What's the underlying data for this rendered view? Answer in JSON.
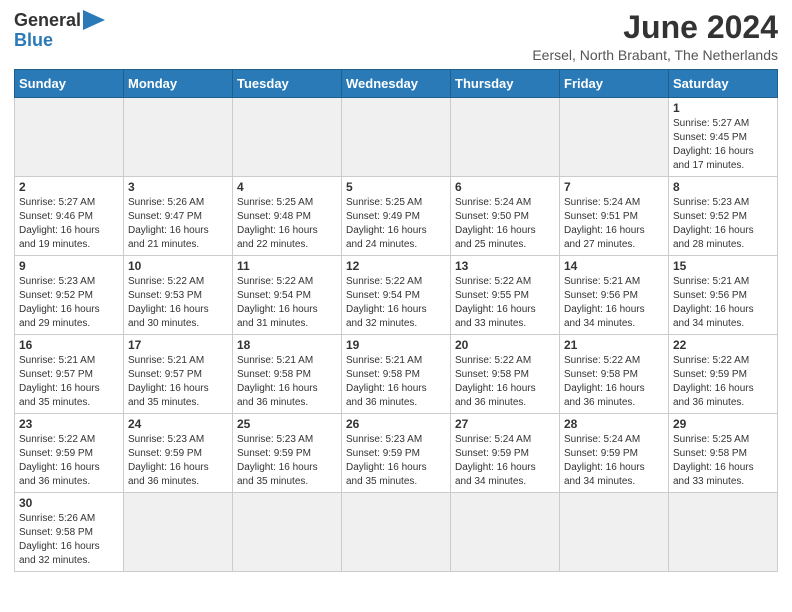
{
  "header": {
    "logo_general": "General",
    "logo_blue": "Blue",
    "month_title": "June 2024",
    "subtitle": "Eersel, North Brabant, The Netherlands"
  },
  "days_of_week": [
    "Sunday",
    "Monday",
    "Tuesday",
    "Wednesday",
    "Thursday",
    "Friday",
    "Saturday"
  ],
  "weeks": [
    [
      {
        "day": "",
        "info": ""
      },
      {
        "day": "",
        "info": ""
      },
      {
        "day": "",
        "info": ""
      },
      {
        "day": "",
        "info": ""
      },
      {
        "day": "",
        "info": ""
      },
      {
        "day": "",
        "info": ""
      },
      {
        "day": "1",
        "info": "Sunrise: 5:27 AM\nSunset: 9:45 PM\nDaylight: 16 hours\nand 17 minutes."
      }
    ],
    [
      {
        "day": "2",
        "info": "Sunrise: 5:27 AM\nSunset: 9:46 PM\nDaylight: 16 hours\nand 19 minutes."
      },
      {
        "day": "3",
        "info": "Sunrise: 5:26 AM\nSunset: 9:47 PM\nDaylight: 16 hours\nand 21 minutes."
      },
      {
        "day": "4",
        "info": "Sunrise: 5:25 AM\nSunset: 9:48 PM\nDaylight: 16 hours\nand 22 minutes."
      },
      {
        "day": "5",
        "info": "Sunrise: 5:25 AM\nSunset: 9:49 PM\nDaylight: 16 hours\nand 24 minutes."
      },
      {
        "day": "6",
        "info": "Sunrise: 5:24 AM\nSunset: 9:50 PM\nDaylight: 16 hours\nand 25 minutes."
      },
      {
        "day": "7",
        "info": "Sunrise: 5:24 AM\nSunset: 9:51 PM\nDaylight: 16 hours\nand 27 minutes."
      },
      {
        "day": "8",
        "info": "Sunrise: 5:23 AM\nSunset: 9:52 PM\nDaylight: 16 hours\nand 28 minutes."
      }
    ],
    [
      {
        "day": "9",
        "info": "Sunrise: 5:23 AM\nSunset: 9:52 PM\nDaylight: 16 hours\nand 29 minutes."
      },
      {
        "day": "10",
        "info": "Sunrise: 5:22 AM\nSunset: 9:53 PM\nDaylight: 16 hours\nand 30 minutes."
      },
      {
        "day": "11",
        "info": "Sunrise: 5:22 AM\nSunset: 9:54 PM\nDaylight: 16 hours\nand 31 minutes."
      },
      {
        "day": "12",
        "info": "Sunrise: 5:22 AM\nSunset: 9:54 PM\nDaylight: 16 hours\nand 32 minutes."
      },
      {
        "day": "13",
        "info": "Sunrise: 5:22 AM\nSunset: 9:55 PM\nDaylight: 16 hours\nand 33 minutes."
      },
      {
        "day": "14",
        "info": "Sunrise: 5:21 AM\nSunset: 9:56 PM\nDaylight: 16 hours\nand 34 minutes."
      },
      {
        "day": "15",
        "info": "Sunrise: 5:21 AM\nSunset: 9:56 PM\nDaylight: 16 hours\nand 34 minutes."
      }
    ],
    [
      {
        "day": "16",
        "info": "Sunrise: 5:21 AM\nSunset: 9:57 PM\nDaylight: 16 hours\nand 35 minutes."
      },
      {
        "day": "17",
        "info": "Sunrise: 5:21 AM\nSunset: 9:57 PM\nDaylight: 16 hours\nand 35 minutes."
      },
      {
        "day": "18",
        "info": "Sunrise: 5:21 AM\nSunset: 9:58 PM\nDaylight: 16 hours\nand 36 minutes."
      },
      {
        "day": "19",
        "info": "Sunrise: 5:21 AM\nSunset: 9:58 PM\nDaylight: 16 hours\nand 36 minutes."
      },
      {
        "day": "20",
        "info": "Sunrise: 5:22 AM\nSunset: 9:58 PM\nDaylight: 16 hours\nand 36 minutes."
      },
      {
        "day": "21",
        "info": "Sunrise: 5:22 AM\nSunset: 9:58 PM\nDaylight: 16 hours\nand 36 minutes."
      },
      {
        "day": "22",
        "info": "Sunrise: 5:22 AM\nSunset: 9:59 PM\nDaylight: 16 hours\nand 36 minutes."
      }
    ],
    [
      {
        "day": "23",
        "info": "Sunrise: 5:22 AM\nSunset: 9:59 PM\nDaylight: 16 hours\nand 36 minutes."
      },
      {
        "day": "24",
        "info": "Sunrise: 5:23 AM\nSunset: 9:59 PM\nDaylight: 16 hours\nand 36 minutes."
      },
      {
        "day": "25",
        "info": "Sunrise: 5:23 AM\nSunset: 9:59 PM\nDaylight: 16 hours\nand 35 minutes."
      },
      {
        "day": "26",
        "info": "Sunrise: 5:23 AM\nSunset: 9:59 PM\nDaylight: 16 hours\nand 35 minutes."
      },
      {
        "day": "27",
        "info": "Sunrise: 5:24 AM\nSunset: 9:59 PM\nDaylight: 16 hours\nand 34 minutes."
      },
      {
        "day": "28",
        "info": "Sunrise: 5:24 AM\nSunset: 9:59 PM\nDaylight: 16 hours\nand 34 minutes."
      },
      {
        "day": "29",
        "info": "Sunrise: 5:25 AM\nSunset: 9:58 PM\nDaylight: 16 hours\nand 33 minutes."
      }
    ],
    [
      {
        "day": "30",
        "info": "Sunrise: 5:26 AM\nSunset: 9:58 PM\nDaylight: 16 hours\nand 32 minutes."
      },
      {
        "day": "",
        "info": ""
      },
      {
        "day": "",
        "info": ""
      },
      {
        "day": "",
        "info": ""
      },
      {
        "day": "",
        "info": ""
      },
      {
        "day": "",
        "info": ""
      },
      {
        "day": "",
        "info": ""
      }
    ]
  ]
}
